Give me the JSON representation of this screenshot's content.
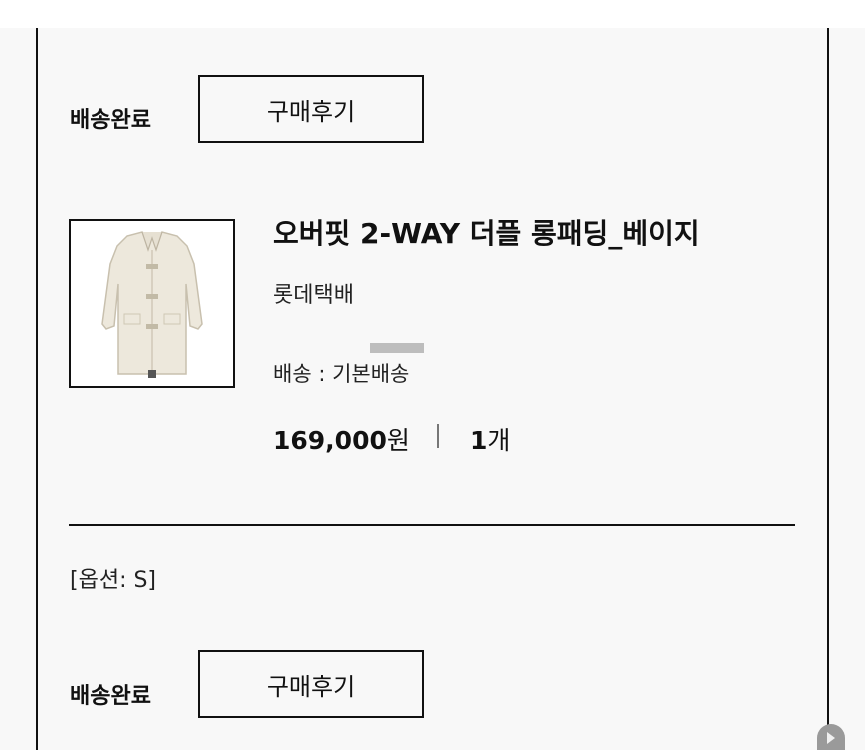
{
  "order_item_top": {
    "status": "배송완료",
    "review_button": "구매후기"
  },
  "product": {
    "name": "오버핏 2-WAY 더플 롱패딩_베이지",
    "carrier": "롯데택배",
    "shipping": "배송 : 기본배송",
    "price_value": "169,000",
    "price_unit": "원",
    "quantity_value": "1",
    "quantity_unit": "개",
    "image_icon": "beige-duffle-padding-coat"
  },
  "option": "[옵션: S]",
  "order_item_bottom": {
    "status": "배송완료",
    "review_button": "구매후기"
  },
  "colors": {
    "background": "#f8f8f8",
    "text": "#111111",
    "border": "#111111",
    "coat": "#ede8dc"
  }
}
